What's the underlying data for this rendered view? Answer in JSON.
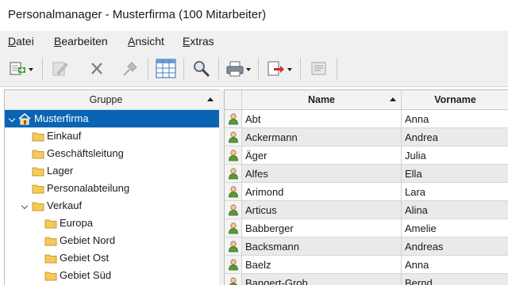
{
  "window": {
    "title": "Personalmanager - Musterfirma (100 Mitarbeiter)"
  },
  "menu": [
    {
      "ul": "D",
      "rest": "atei"
    },
    {
      "ul": "B",
      "rest": "earbeiten"
    },
    {
      "ul": "A",
      "rest": "nsicht"
    },
    {
      "ul": "E",
      "rest": "xtras"
    }
  ],
  "toolbar": {
    "icons": [
      "new-record-icon",
      "edit-icon",
      "delete-icon",
      "pin-icon",
      "grid-view-icon",
      "search-icon",
      "print-icon",
      "export-icon",
      "report-icon"
    ]
  },
  "tree": {
    "header": "Gruppe",
    "root": "Musterfirma",
    "items": [
      {
        "label": "Einkauf"
      },
      {
        "label": "Geschäftsleitung"
      },
      {
        "label": "Lager"
      },
      {
        "label": "Personalabteilung"
      },
      {
        "label": "Verkauf"
      },
      {
        "label": "Europa"
      },
      {
        "label": "Gebiet Nord"
      },
      {
        "label": "Gebiet Ost"
      },
      {
        "label": "Gebiet Süd"
      }
    ]
  },
  "grid": {
    "columns": {
      "name": "Name",
      "vorname": "Vorname"
    },
    "rows": [
      {
        "name": "Abt",
        "vorname": "Anna"
      },
      {
        "name": "Ackermann",
        "vorname": "Andrea"
      },
      {
        "name": "Äger",
        "vorname": "Julia"
      },
      {
        "name": "Alfes",
        "vorname": "Ella"
      },
      {
        "name": "Arimond",
        "vorname": "Lara"
      },
      {
        "name": "Articus",
        "vorname": "Alina"
      },
      {
        "name": "Babberger",
        "vorname": "Amelie"
      },
      {
        "name": "Backsmann",
        "vorname": "Andreas"
      },
      {
        "name": "Baelz",
        "vorname": "Anna"
      },
      {
        "name": "Bangert-Grob",
        "vorname": "Bernd"
      }
    ]
  }
}
